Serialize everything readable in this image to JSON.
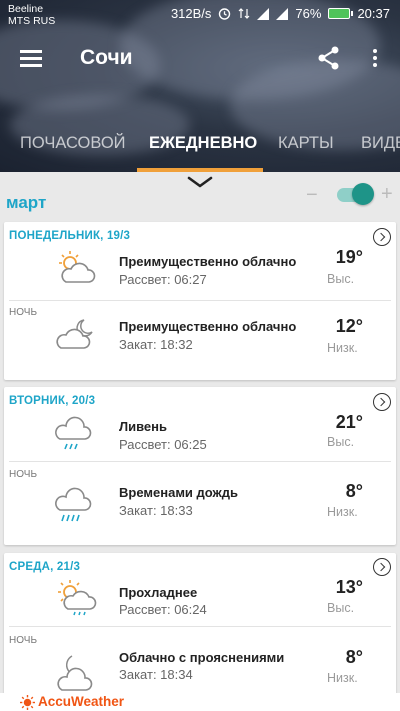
{
  "status_bar": {
    "carrier_line1": "Beeline",
    "carrier_line2": "MTS RUS",
    "network_speed": "312B/s",
    "battery": "76%",
    "time": "20:37"
  },
  "app_bar": {
    "city": "Сочи",
    "menu_icon": "hamburger-icon",
    "share_icon": "share-icon",
    "more_icon": "more-vert-icon"
  },
  "tabs": [
    {
      "label": "ПОЧАСОВОЙ",
      "active": false
    },
    {
      "label": "ЕЖЕДНЕВНО",
      "active": true
    },
    {
      "label": "КАРТЫ",
      "active": false
    },
    {
      "label": "ВИДЕ",
      "active": false
    }
  ],
  "controls": {
    "month": "март",
    "minus": "−",
    "plus": "+",
    "toggle_on": true
  },
  "colors": {
    "accent": "#1ea5c8",
    "tab_indicator": "#f0a03a",
    "toggle": "#1e9488",
    "brand": "#f05514"
  },
  "days": [
    {
      "label": "ПОНЕДЕЛЬНИК, 19/3",
      "day": {
        "icon": "partly-sunny-icon",
        "desc": "Преимущественно облачно",
        "sub": "Рассвет: 06:27",
        "temp": "19°",
        "temp_label": "Выс."
      },
      "night_label": "НОЧЬ",
      "night": {
        "icon": "moon-cloud-icon",
        "desc": "Преимущественно облачно",
        "sub": "Закат: 18:32",
        "temp": "12°",
        "temp_label": "Низк."
      }
    },
    {
      "label": "ВТОРНИК, 20/3",
      "day": {
        "icon": "rain-cloud-icon",
        "desc": "Ливень",
        "sub": "Рассвет: 06:25",
        "temp": "21°",
        "temp_label": "Выс."
      },
      "night_label": "НОЧЬ",
      "night": {
        "icon": "rain-cloud-icon",
        "desc": "Временами дождь",
        "sub": "Закат: 18:33",
        "temp": "8°",
        "temp_label": "Низк."
      }
    },
    {
      "label": "СРЕДА, 21/3",
      "day": {
        "icon": "sun-cloud-icon",
        "desc": "Прохладнее",
        "sub": "Рассвет: 06:24",
        "temp": "13°",
        "temp_label": "Выс."
      },
      "night_label": "НОЧЬ",
      "night": {
        "icon": "moon-cloud-icon",
        "desc": "Облачно с прояснениями",
        "sub": "Закат: 18:34",
        "temp": "8°",
        "temp_label": "Низк."
      }
    }
  ],
  "footer": {
    "brand": "AccuWeather"
  }
}
